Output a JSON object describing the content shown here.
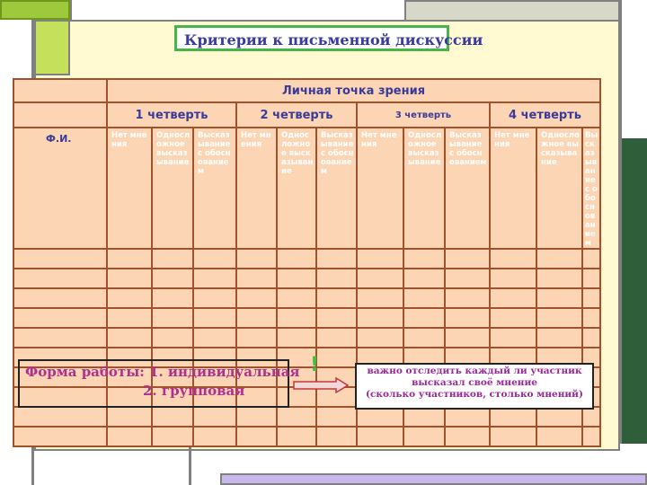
{
  "title": "Критерии к письменной дискуссии",
  "table": {
    "header": "Личная точка зрения",
    "quarters": [
      "1 четверть",
      "2 четверть",
      "3 четверть",
      "4 четверть"
    ],
    "fio_label": "Ф.И.",
    "criteria": [
      "Нет мнения",
      "Односложное высказывание",
      "Высказывание с обоснованием",
      "Нет мнения",
      "Односложное высказывание",
      "Высказывание с обоснованием",
      "Нет мнения",
      "Односложное высказывание",
      "Высказывание с обоснованием",
      "Нет мнения",
      "Односложное высказывание",
      "Высказывание с обоснованием"
    ]
  },
  "form_of_work": {
    "line1": "Форма работы: 1. индивидуальная",
    "line2": "2. групповая"
  },
  "exclamation": "!",
  "note": {
    "line1": "важно отследить каждый ли участник",
    "line2": "высказал своё мнение",
    "line3": "(сколько участников, столько мнений)"
  },
  "colors": {
    "table_fill": "#fcd5b4",
    "table_border": "#a0522d",
    "title_border": "#49b44a",
    "form_text": "#b03090",
    "note_text": "#9a2a9a"
  }
}
